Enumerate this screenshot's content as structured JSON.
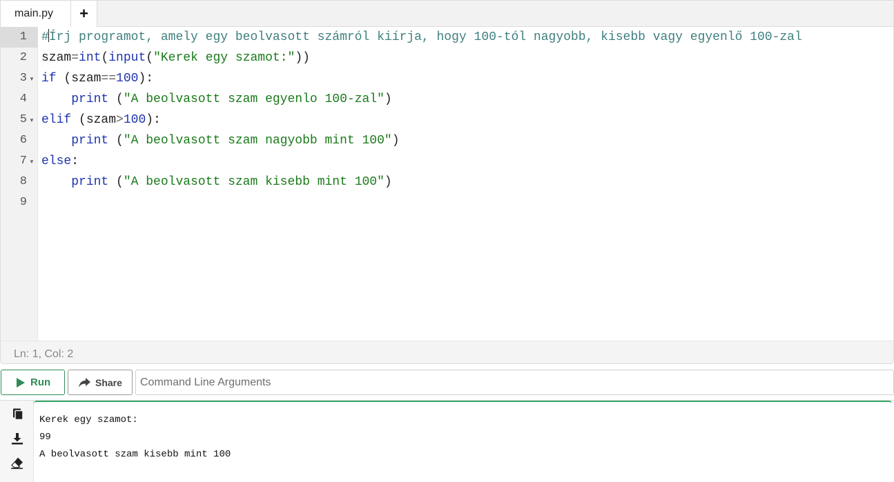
{
  "editor": {
    "tab_label": "main.py",
    "add_tab_label": "+",
    "line_numbers": [
      "1",
      "2",
      "3",
      "4",
      "5",
      "6",
      "7",
      "8",
      "9"
    ],
    "lines": [
      [
        {
          "t": "#Írj programot, amely egy beolvasott számról kiírja, hogy 100-tól nagyobb, kisebb vagy egyenlő 100-zal",
          "c": "comment"
        }
      ],
      [
        {
          "t": "szam",
          "c": "plain"
        },
        {
          "t": "=",
          "c": "op"
        },
        {
          "t": "int",
          "c": "builtin"
        },
        {
          "t": "(",
          "c": "plain"
        },
        {
          "t": "input",
          "c": "builtin"
        },
        {
          "t": "(",
          "c": "plain"
        },
        {
          "t": "\"Kerek egy szamot:\"",
          "c": "str"
        },
        {
          "t": "))",
          "c": "plain"
        }
      ],
      [
        {
          "t": "if",
          "c": "kw"
        },
        {
          "t": " (szam",
          "c": "plain"
        },
        {
          "t": "==",
          "c": "op"
        },
        {
          "t": "100",
          "c": "num"
        },
        {
          "t": "):",
          "c": "plain"
        }
      ],
      [
        {
          "t": "    ",
          "c": "plain"
        },
        {
          "t": "print",
          "c": "builtin"
        },
        {
          "t": " (",
          "c": "plain"
        },
        {
          "t": "\"A beolvasott szam egyenlo 100-zal\"",
          "c": "str"
        },
        {
          "t": ")",
          "c": "plain"
        }
      ],
      [
        {
          "t": "elif",
          "c": "kw"
        },
        {
          "t": " (szam",
          "c": "plain"
        },
        {
          "t": ">",
          "c": "op"
        },
        {
          "t": "100",
          "c": "num"
        },
        {
          "t": "):",
          "c": "plain"
        }
      ],
      [
        {
          "t": "    ",
          "c": "plain"
        },
        {
          "t": "print",
          "c": "builtin"
        },
        {
          "t": " (",
          "c": "plain"
        },
        {
          "t": "\"A beolvasott szam nagyobb mint 100\"",
          "c": "str"
        },
        {
          "t": ")",
          "c": "plain"
        }
      ],
      [
        {
          "t": "else",
          "c": "kw"
        },
        {
          "t": ":",
          "c": "plain"
        }
      ],
      [
        {
          "t": "    ",
          "c": "plain"
        },
        {
          "t": "print",
          "c": "builtin"
        },
        {
          "t": " (",
          "c": "plain"
        },
        {
          "t": "\"A beolvasott szam kisebb mint 100\"",
          "c": "str"
        },
        {
          "t": ")",
          "c": "plain"
        }
      ],
      []
    ],
    "status": "Ln: 1,  Col: 2"
  },
  "actions": {
    "run_label": "Run",
    "share_label": "Share",
    "args_placeholder": "Command Line Arguments"
  },
  "output": {
    "lines": [
      "Kerek egy szamot:",
      "99",
      "A beolvasott szam kisebb mint 100"
    ]
  },
  "colors": {
    "comment": "#3f7f7f",
    "keyword": "#1f33b0",
    "string": "#1a7a1a",
    "run_accent": "#2e8b57",
    "output_border": "#3aa86b"
  },
  "icons": {
    "run": "play-icon",
    "share": "share-icon",
    "copy": "copy-icon",
    "download": "download-icon",
    "clear": "eraser-icon"
  }
}
